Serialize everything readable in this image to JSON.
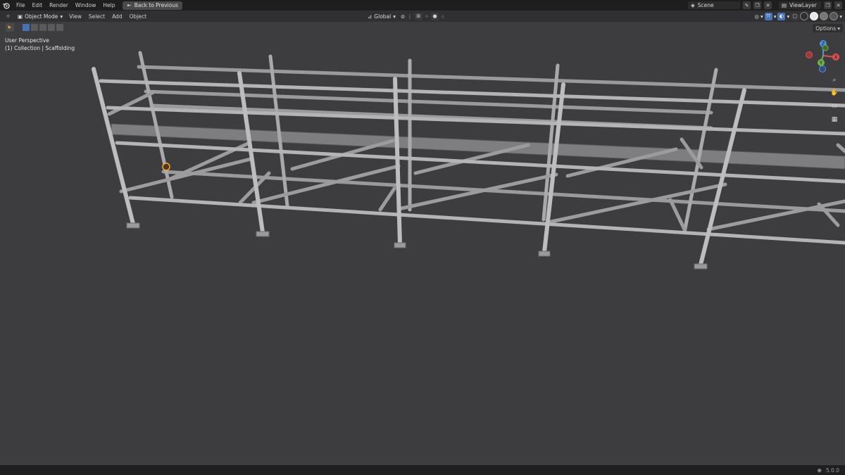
{
  "topbar": {
    "menu": [
      "File",
      "Edit",
      "Render",
      "Window",
      "Help"
    ],
    "back_label": "Back to Previous",
    "scene": "Scene",
    "view_layer": "ViewLayer"
  },
  "header": {
    "mode": "Object Mode",
    "menu": [
      "View",
      "Select",
      "Add",
      "Object"
    ],
    "transform_orientation": "Global",
    "options_label": "Options"
  },
  "viewport": {
    "perspective": "User Perspective",
    "collection": "(1) Collection | Scaffolding"
  },
  "gizmo": {
    "x": "X",
    "y": "Y",
    "z": "Z"
  },
  "statusbar": {
    "version": "5.0.0"
  }
}
